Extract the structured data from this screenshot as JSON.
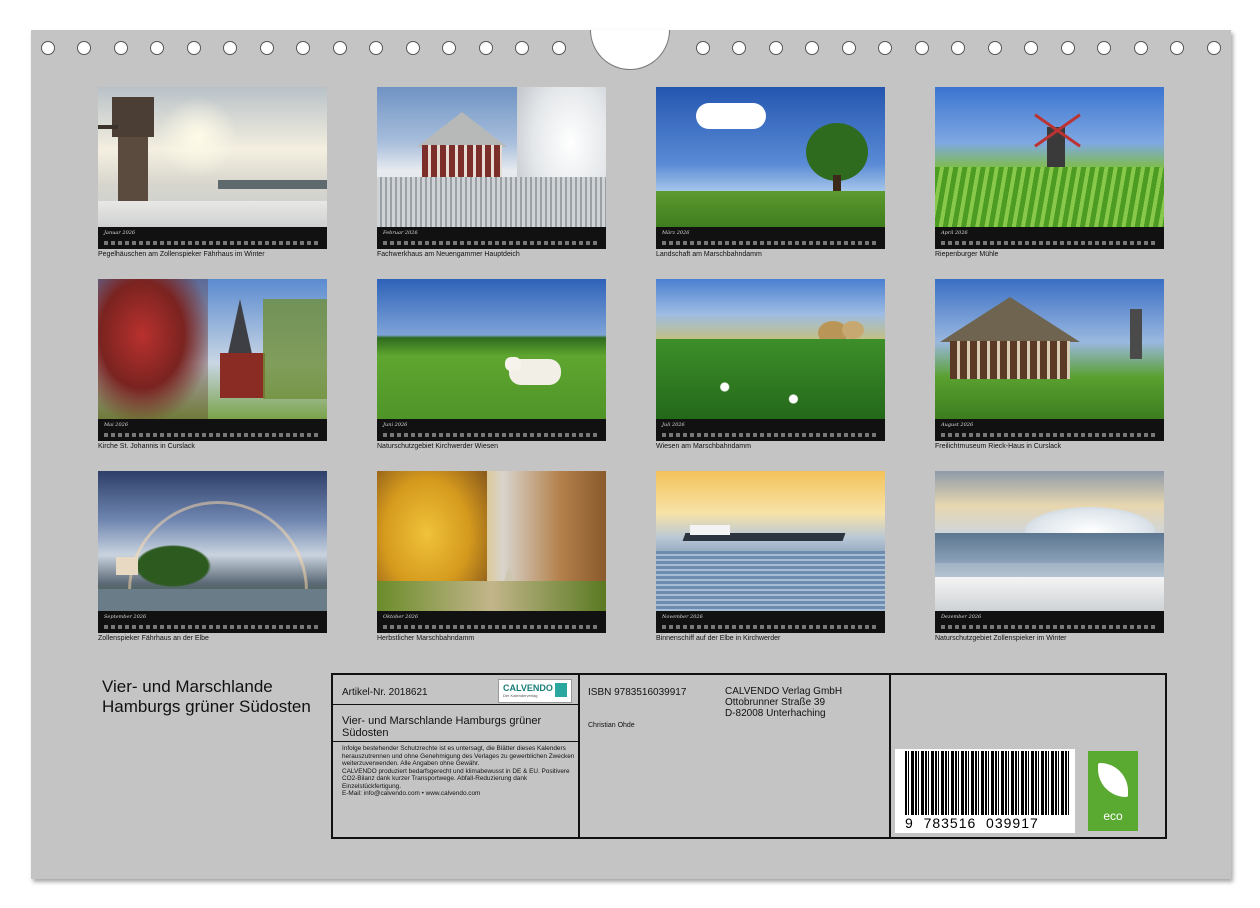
{
  "months": [
    {
      "month": "Januar 2026",
      "caption": "Pegelhäuschen am Zollenspieker Fährhaus im Winter"
    },
    {
      "month": "Februar 2026",
      "caption": "Fachwerkhaus am Neuengammer Hauptdeich"
    },
    {
      "month": "März 2026",
      "caption": "Landschaft am Marschbahndamm"
    },
    {
      "month": "April 2026",
      "caption": "Riepenburger Mühle"
    },
    {
      "month": "Mai 2026",
      "caption": "Kirche St. Johannis in Curslack"
    },
    {
      "month": "Juni 2026",
      "caption": "Naturschutzgebiet Kirchwerder Wiesen"
    },
    {
      "month": "Juli 2026",
      "caption": "Wiesen am Marschbahndamm"
    },
    {
      "month": "August 2026",
      "caption": "Freilichtmuseum Rieck-Haus in Curslack"
    },
    {
      "month": "September 2026",
      "caption": "Zollenspieker Fährhaus an der Elbe"
    },
    {
      "month": "Oktober 2026",
      "caption": "Herbstlicher Marschbahndamm"
    },
    {
      "month": "November 2026",
      "caption": "Binnenschiff auf der Elbe in Kirchwerder"
    },
    {
      "month": "Dezember 2026",
      "caption": "Naturschutzgebiet Zollenspieker im Winter"
    }
  ],
  "calendar_title": "Vier- und Marschlande Hamburgs grüner Südosten",
  "info": {
    "article": "Artikel-Nr. 2018621",
    "logo_text": "CALVENDO",
    "logo_sub": "Der Kalenderverlag",
    "title": "Vier- und Marschlande Hamburgs grüner Südosten",
    "legal": "Infolge bestehender Schutzrechte ist es untersagt, die Blätter dieses Kalenders herauszutrennen und ohne Genehmigung des Verlages zu gewerblichen Zwecken weiterzuverwenden. Alle Angaben ohne Gewähr.\nCALVENDO produziert bedarfsgerecht und klimabewusst in DE & EU. Positivere CO2-Bilanz dank kurzer Transportwege. Abfall-Reduzierung dank Einzelstückfertigung.\nE-Mail: info@calvendo.com • www.calvendo.com",
    "isbn": "ISBN 9783516039917",
    "author": "Christian Ohde",
    "publisher": [
      "CALVENDO Verlag GmbH",
      "Ottobrunner Straße 39",
      "D-82008 Unterhaching"
    ],
    "barcode_digits": "9  783516  039917",
    "eco_label": "eco"
  }
}
